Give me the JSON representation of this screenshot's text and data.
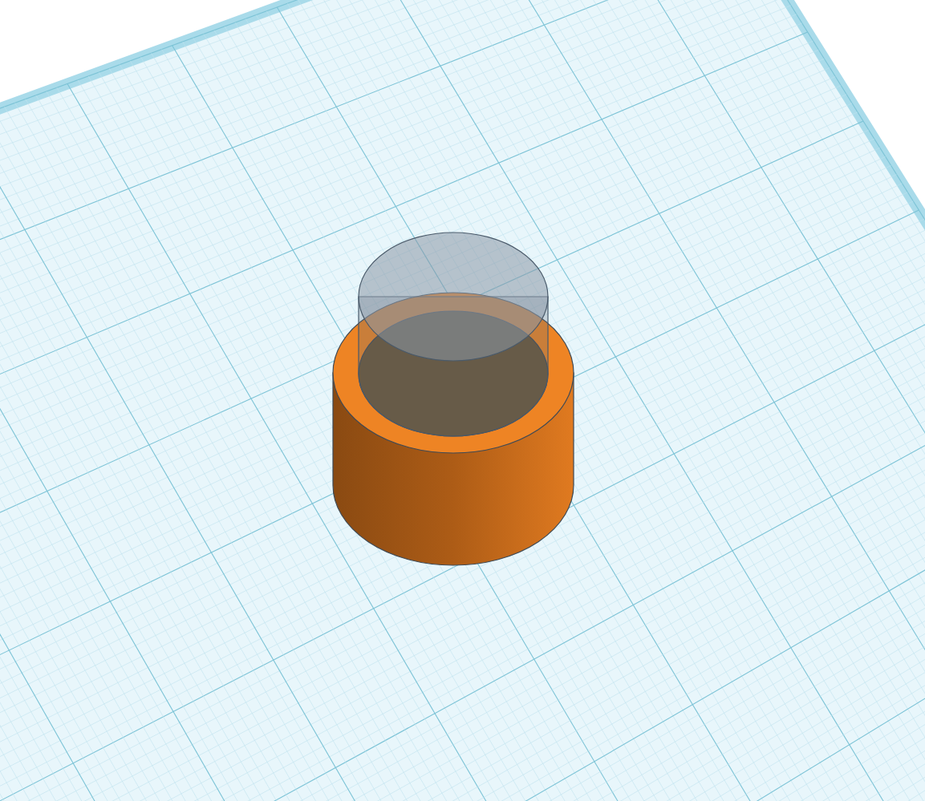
{
  "workplane": {
    "shapes": [
      {
        "kind": "solid"
      },
      {
        "kind": "hole"
      }
    ]
  }
}
